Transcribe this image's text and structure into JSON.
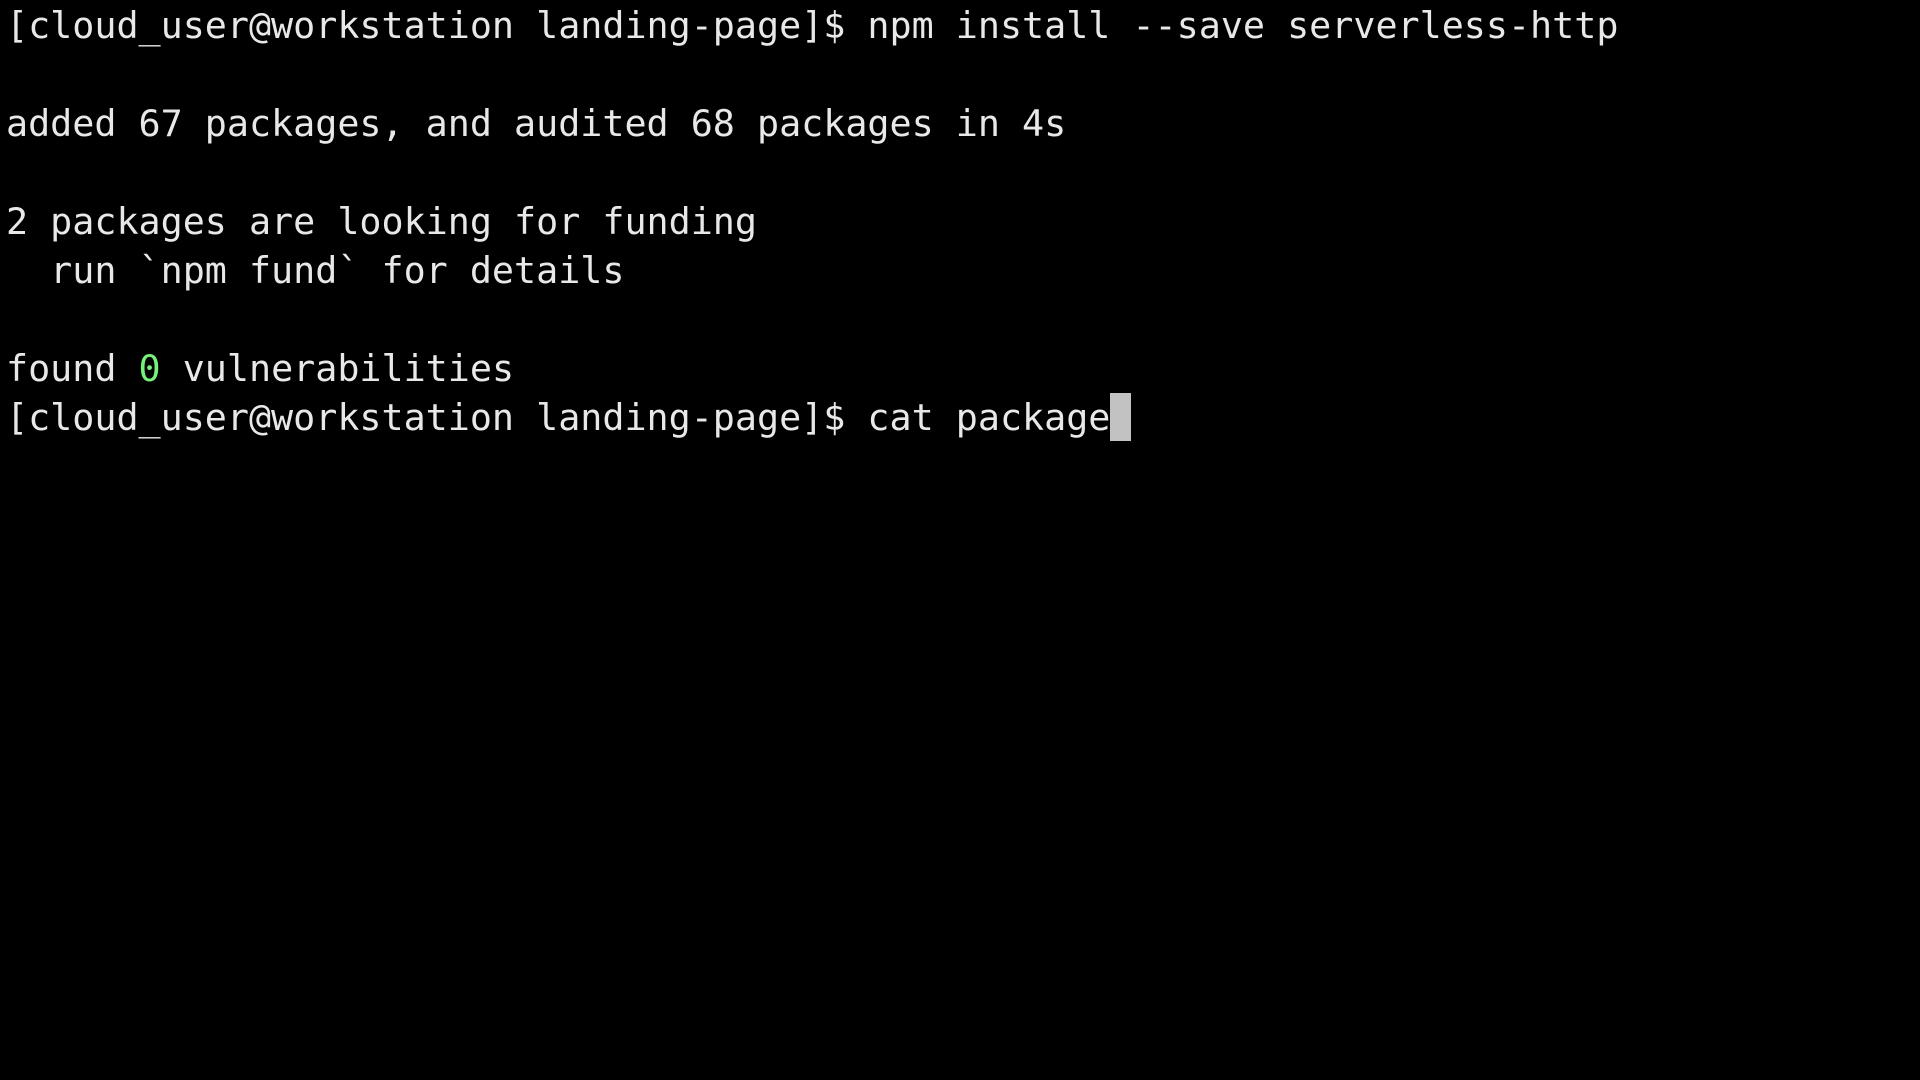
{
  "terminal": {
    "prompt": "[cloud_user@workstation landing-page]$ ",
    "line1_command": "npm install --save serverless-http",
    "line3": "added 67 packages, and audited 68 packages in 4s",
    "line5": "2 packages are looking for funding",
    "line6": "  run `npm fund` for details",
    "line8_prefix": "found ",
    "line8_count": "0",
    "line8_suffix": " vulnerabilities",
    "line9_command": "cat package"
  },
  "colors": {
    "background": "#000000",
    "text": "#e8e8e8",
    "highlight_green": "#76f27a",
    "cursor": "#c2c2c2"
  }
}
